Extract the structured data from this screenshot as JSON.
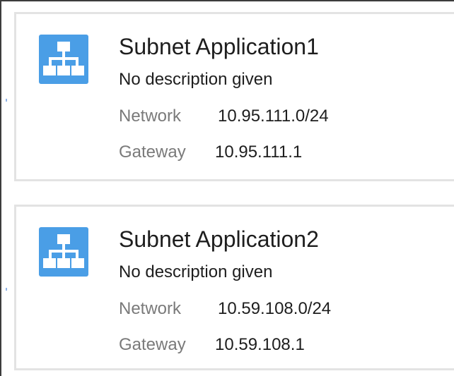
{
  "subnets": [
    {
      "icon": "network-topology-icon",
      "name": "Subnet Application1",
      "description": "No description given",
      "network_label": "Network",
      "network": "10.95.111.0/24",
      "gateway_label": "Gateway",
      "gateway": "10.95.111.1"
    },
    {
      "icon": "network-topology-icon",
      "name": "Subnet Application2",
      "description": "No description given",
      "network_label": "Network",
      "network": "10.59.108.0/24",
      "gateway_label": "Gateway",
      "gateway": "10.59.108.1"
    }
  ],
  "colors": {
    "icon_background": "#4a9ee6",
    "card_border": "#e3e3e3",
    "label_text": "#7a7a7a",
    "value_text": "#1e1e1e"
  }
}
